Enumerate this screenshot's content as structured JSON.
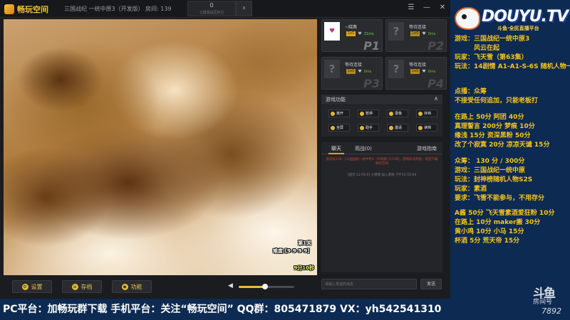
{
  "app": {
    "logo_text": "畅玩空间",
    "game_title": "三国战纪 一统中原3（开发版）",
    "room_label": "房间: 139",
    "region_value": "0",
    "region_sub": "七雄混战区积分",
    "region_next": "›",
    "window_buttons": [
      "☰",
      "—",
      "✕"
    ]
  },
  "game": {
    "stage_line1": "第1关",
    "stage_line2": "难度:[9-9-9-9]",
    "stage_line3": "9分10秒"
  },
  "toolbar": {
    "settings_label": "设置",
    "save_label": "存档",
    "function_label": "功能",
    "volume_level": 0.48
  },
  "players": [
    {
      "name": "~晓燕",
      "tag": "1x1",
      "ping": "21ms",
      "p": "P1",
      "filled": true,
      "avatar": "♥"
    },
    {
      "name": "等待连接",
      "tag": "1x0",
      "ping": "0ms",
      "p": "P2",
      "filled": false,
      "avatar": "?"
    },
    {
      "name": "等待连接",
      "tag": "1x0",
      "ping": "0ms",
      "p": "P3",
      "filled": false,
      "avatar": "?"
    },
    {
      "name": "等待连接",
      "tag": "1x0",
      "ping": "0ms",
      "p": "P4",
      "filled": false,
      "avatar": "?"
    }
  ],
  "functions": {
    "title": "游戏功能",
    "chevron": "∧",
    "buttons": [
      "离开",
      "暂停",
      "录像",
      "存档",
      "全屏",
      "助手",
      "邀请",
      "读档"
    ]
  },
  "chat": {
    "tab_chat": "聊天",
    "tab_watch": "观战(0)",
    "tab_guide": "游戏指南",
    "system_msg": "房间号139，[三国战纪一统中原3（开发版）]-[139]，游戏房间开始，欢迎下载畅玩空间",
    "time_msg": "[提示 12:05:0] 小游戏 加入游戏 下午15:55:04",
    "input_placeholder": "请输入发送的消息",
    "send_label": "发送"
  },
  "douyu": {
    "word": "DOUYU.TV",
    "tag": "斗鱼·全民直播平台",
    "room_big": "斗鱼",
    "room_label": "房间号",
    "room_num": "7892"
  },
  "info_lines": [
    {
      "text": "游戏：三国战纪一统中原3",
      "color": "#f6c419"
    },
    {
      "text": "　　　风云在起",
      "color": "#f6c419"
    },
    {
      "text": "玩家：飞天雪（第63集）",
      "color": "#f6c419"
    },
    {
      "text": "玩法：14剧情 A1-A1-S-6S 随机人物一",
      "color": "#f6c419"
    },
    {
      "text": "点播：众筹",
      "color": "#f6c419"
    },
    {
      "text": "不接受任何追加，只能老板打",
      "color": "#f6c419"
    },
    {
      "text": "在路上 50分  阿团 40分",
      "color": "#f6c419"
    },
    {
      "text": "真理誓言 200分 梦痕 10分",
      "color": "#f6c419"
    },
    {
      "text": "缘浅 15分  资深黑粉 50分",
      "color": "#f6c419"
    },
    {
      "text": "改了个寂寞 20分  凉凉天谴 15分",
      "color": "#f6c419"
    },
    {
      "text": "众筹：   130 分 / 300分",
      "color": "#f6c419"
    },
    {
      "text": "游戏：三国战纪一统中原",
      "color": "#f6c419"
    },
    {
      "text": "玩法：封神榜随机人物S2S",
      "color": "#f6c419"
    },
    {
      "text": "玩家：素酒",
      "color": "#f6c419"
    },
    {
      "text": "要求：飞雪不能参与，不用存分",
      "color": "#f6c419"
    },
    {
      "text": "A酱 50分  飞天雪素酒爱狂粉 10分",
      "color": "#f6c419"
    },
    {
      "text": "在路上 10分   maker搬 30分",
      "color": "#f6c419"
    },
    {
      "text": "黄小鸡  10分  小马 15分",
      "color": "#f6c419"
    },
    {
      "text": "杯酒 5分    荒天帝 15分",
      "color": "#f6c419"
    }
  ],
  "banner": {
    "text": "PC平台：加畅玩群下载 手机平台：关注“畅玩空间” QQ群：805471879 VX：yh542541310"
  }
}
